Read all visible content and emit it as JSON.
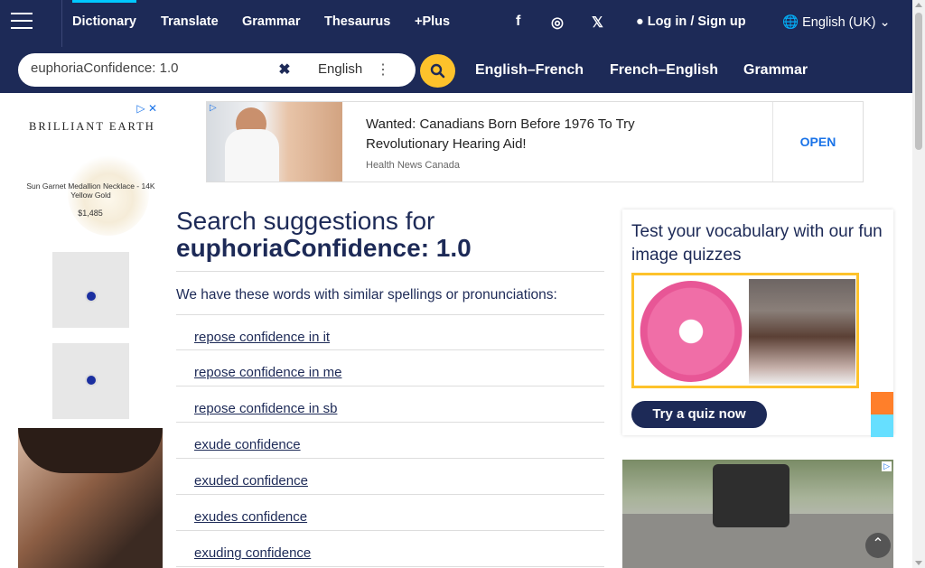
{
  "nav": {
    "links": [
      "Dictionary",
      "Translate",
      "Grammar",
      "Thesaurus",
      "+Plus"
    ],
    "social": {
      "facebook": "f",
      "instagram": "◎",
      "x": "𝕏"
    },
    "login": "Log in",
    "separator": "/",
    "signup": "Sign up",
    "language": "English (UK)"
  },
  "search": {
    "value": "euphoriaConfidence: 1.0",
    "language": "English"
  },
  "tabs": [
    "English–French",
    "French–English",
    "Grammar"
  ],
  "left_ad": {
    "brand": "BRILLIANT EARTH",
    "product": "Sun Garnet Medallion Necklace - 14K Yellow Gold",
    "price": "$1,485"
  },
  "banner_ad": {
    "headline": "Wanted: Canadians Born Before 1976 To Try Revolutionary Hearing Aid!",
    "source": "Health News Canada",
    "cta": "OPEN"
  },
  "main": {
    "title_prefix": "Search suggestions for",
    "term": "euphoriaConfidence: 1.0",
    "intro": "We have these words with similar spellings or pronunciations:",
    "suggestions": [
      "repose confidence in it",
      "repose confidence in me",
      "repose confidence in sb",
      "exude confidence",
      "exuded confidence",
      "exudes confidence",
      "exuding confidence"
    ]
  },
  "quiz": {
    "title": "Test your vocabulary with our fun image quizzes",
    "cta": "Try a quiz now"
  },
  "colors": {
    "navy": "#1d2a57",
    "accent": "#fdc22b",
    "link": "#1a73e8"
  }
}
